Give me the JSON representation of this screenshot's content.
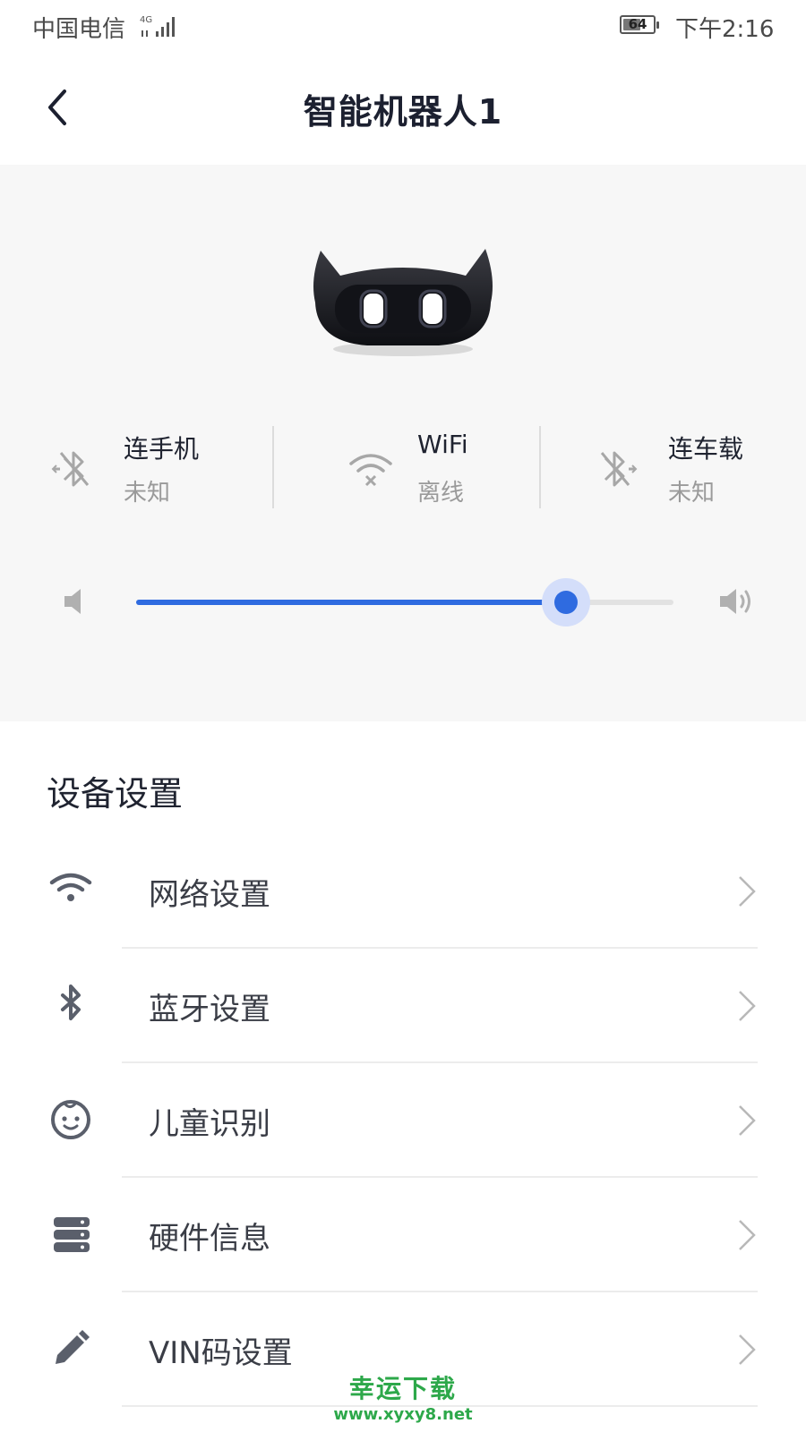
{
  "status_bar": {
    "carrier": "中国电信",
    "network": "4G",
    "battery": "64",
    "battery_level": 0.64,
    "time": "下午2:16"
  },
  "header": {
    "title": "智能机器人1",
    "back_icon": "chevron-left-icon"
  },
  "connections": [
    {
      "title": "连手机",
      "value": "未知",
      "icon": "bluetooth-off-icon"
    },
    {
      "title": "WiFi",
      "value": "离线",
      "icon": "wifi-off-icon"
    },
    {
      "title": "连车载",
      "value": "未知",
      "icon": "bluetooth-off-icon"
    }
  ],
  "volume": {
    "level": 0.8,
    "low_icon": "volume-low-icon",
    "high_icon": "volume-high-icon"
  },
  "settings": {
    "section_title": "设备设置",
    "items": [
      {
        "label": "网络设置",
        "icon": "wifi-icon"
      },
      {
        "label": "蓝牙设置",
        "icon": "bluetooth-icon"
      },
      {
        "label": "儿童识别",
        "icon": "child-face-icon"
      },
      {
        "label": "硬件信息",
        "icon": "server-icon"
      },
      {
        "label": "VIN码设置",
        "icon": "pencil-icon"
      }
    ]
  },
  "colors": {
    "accent": "#2f6be0",
    "panel_bg": "#f7f7f7",
    "watermark": "#2da84a"
  },
  "watermark": {
    "line1": "幸运下载",
    "line2": "www.xyxy8.net"
  }
}
